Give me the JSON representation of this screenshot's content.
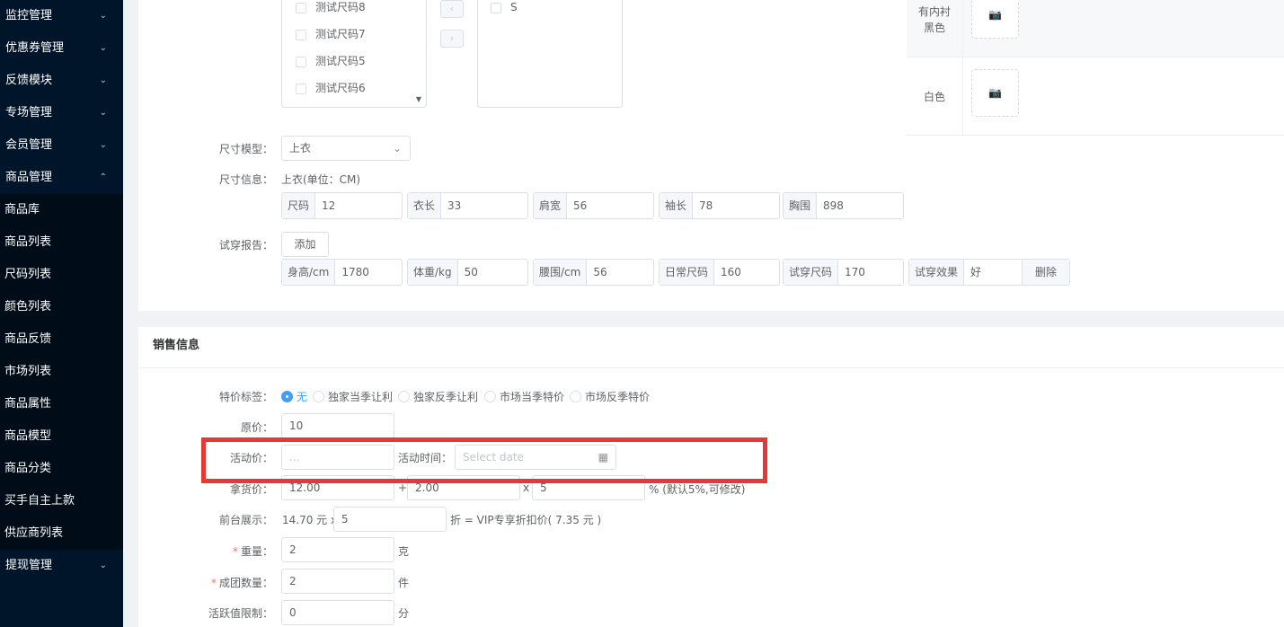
{
  "sidebar": {
    "top_items": [
      "监控管理",
      "优惠券管理",
      "反馈模块",
      "专场管理",
      "会员管理",
      "商品管理"
    ],
    "sub_items": [
      "商品库",
      "商品列表",
      "尺码列表",
      "颜色列表",
      "商品反馈",
      "市场列表",
      "商品属性",
      "商品模型",
      "商品分类",
      "买手自主上款",
      "供应商列表"
    ],
    "bottom_items": [
      "提现管理"
    ]
  },
  "transfer": {
    "left_items": [
      "测试尺码8",
      "测试尺码7",
      "测试尺码5",
      "测试尺码6"
    ],
    "left_arrow": "‹",
    "right_arrow": "›",
    "right_items": [
      "S"
    ]
  },
  "colors": {
    "rows": [
      {
        "name_line1": "有内衬",
        "name_line2": "黑色"
      },
      {
        "name_line1": "白色",
        "name_line2": ""
      }
    ]
  },
  "size_model": {
    "label": "尺寸模型：",
    "value": "上衣"
  },
  "size_info": {
    "label": "尺寸信息：",
    "unit_text": "上衣(单位：CM)",
    "fields": [
      {
        "name": "尺码",
        "value": "12"
      },
      {
        "name": "衣长",
        "value": "33"
      },
      {
        "name": "肩宽",
        "value": "56"
      },
      {
        "name": "袖长",
        "value": "78"
      },
      {
        "name": "胸围",
        "value": "898"
      }
    ]
  },
  "try_report": {
    "label": "试穿报告：",
    "add_button": "添加",
    "fields": [
      {
        "name": "身高/cm",
        "value": "1780"
      },
      {
        "name": "体重/kg",
        "value": "50"
      },
      {
        "name": "腰围/cm",
        "value": "56"
      },
      {
        "name": "日常尺码",
        "value": "160"
      },
      {
        "name": "试穿尺码",
        "value": "170"
      },
      {
        "name": "试穿效果",
        "value": "好"
      }
    ],
    "delete_button": "删除"
  },
  "sales": {
    "title": "销售信息",
    "special_tag_label": "特价标签：",
    "special_tags": [
      "无",
      "独家当季让利",
      "独家反季让利",
      "市场当季特价",
      "市场反季特价"
    ],
    "original_price_label": "原价：",
    "original_price": "10",
    "activity_price_label": "活动价：",
    "activity_price_placeholder": "...",
    "activity_time_label": "活动时间：",
    "activity_time_placeholder": "Select date",
    "cost_label": "拿货价：",
    "cost_value": "12.00",
    "plus": "+",
    "extra_value": "2.00",
    "times": "x",
    "percent_value": "5",
    "percent_note": "% (默认5%,可修改)",
    "display_label": "前台展示：",
    "display_price_text": "14.70 元 x",
    "discount_value": "5",
    "vip_text": "折 = VIP专享折扣价( 7.35 元 )",
    "weight_label": "重量：",
    "weight_value": "2",
    "weight_unit": "克",
    "group_label": "成团数量：",
    "group_value": "2",
    "group_unit": "件",
    "activity_limit_label": "活跃值限制：",
    "activity_limit_value": "0",
    "activity_limit_unit": "分",
    "required_mark": "*"
  }
}
